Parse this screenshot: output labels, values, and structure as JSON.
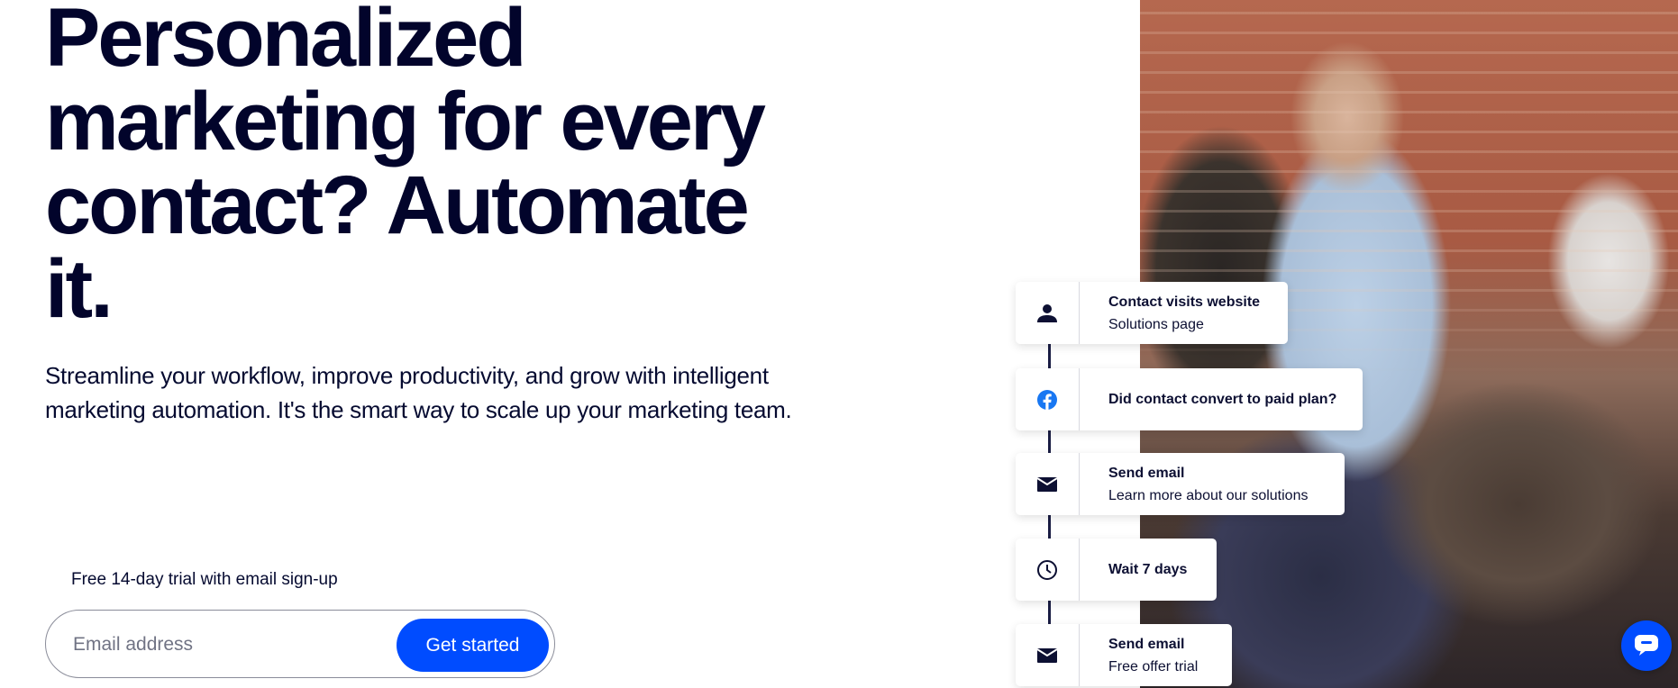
{
  "hero": {
    "headline_lines": [
      "Personalized",
      "marketing for every",
      "contact? Automate",
      "it."
    ],
    "subheading": "Streamline your workflow, improve productivity, and grow with intelligent marketing automation. It's the smart way to scale up your marketing team.",
    "trial_label": "Free 14-day trial with email sign-up",
    "email_placeholder": "Email address",
    "email_value": "",
    "cta_label": "Get started"
  },
  "workflow": {
    "steps": [
      {
        "icon": "person-icon",
        "title": "Contact visits website",
        "detail": "Solutions page"
      },
      {
        "icon": "facebook-icon",
        "title": "Did contact convert to paid plan?"
      },
      {
        "icon": "envelope-icon",
        "title": "Send email",
        "detail": "Learn more about our solutions"
      },
      {
        "icon": "clock-icon",
        "title": "Wait 7 days"
      },
      {
        "icon": "envelope-icon",
        "title": "Send email",
        "detail": "Free offer trial"
      }
    ]
  },
  "colors": {
    "brand_blue": "#004cff",
    "navy_text": "#02042b"
  },
  "chat": {
    "icon": "chat-bubble-icon"
  }
}
